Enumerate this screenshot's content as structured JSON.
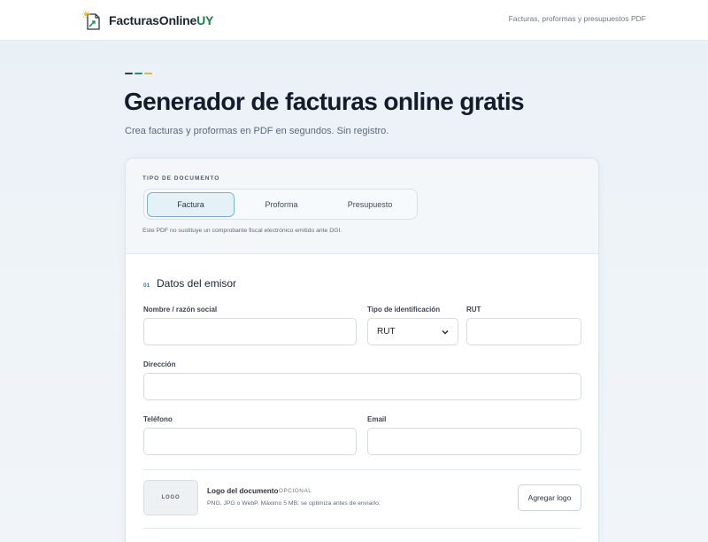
{
  "header": {
    "brand_main": "FacturasOnline",
    "brand_suffix": "UY",
    "tagline": "Facturas, proformas y presupuestos PDF"
  },
  "hero": {
    "title": "Generador de facturas online gratis",
    "subtitle": "Crea facturas y proformas en PDF en segundos. Sin registro.",
    "dash_colors": [
      "#2a3b4c",
      "#2f8a63",
      "#e0b43a"
    ]
  },
  "doc_type": {
    "label": "TIPO DE DOCUMENTO",
    "options": [
      "Factura",
      "Proforma",
      "Presupuesto"
    ],
    "selected": "Factura",
    "note": "Este PDF no sustituye un comprobante fiscal electrónico emitido ante DGI."
  },
  "emisor": {
    "step_number": "01",
    "title": "Datos del emisor",
    "name_label": "Nombre / razón social",
    "name_value": "",
    "id_type_label": "Tipo de identificación",
    "id_type_value": "RUT",
    "rut_label": "RUT",
    "rut_value": "",
    "address_label": "Dirección",
    "address_value": "",
    "phone_label": "Teléfono",
    "phone_value": "",
    "email_label": "Email",
    "email_value": ""
  },
  "logo_section": {
    "placeholder": "LOGO",
    "title": "Logo del documento",
    "optional": "OPCIONAL",
    "help": "PNG, JPG o WebP. Máximo 5 MB; se optimiza antes de enviarlo.",
    "button": "Agregar logo"
  },
  "colors": {
    "accent": "#7fb3cc",
    "brand_green": "#1f7a4a"
  }
}
